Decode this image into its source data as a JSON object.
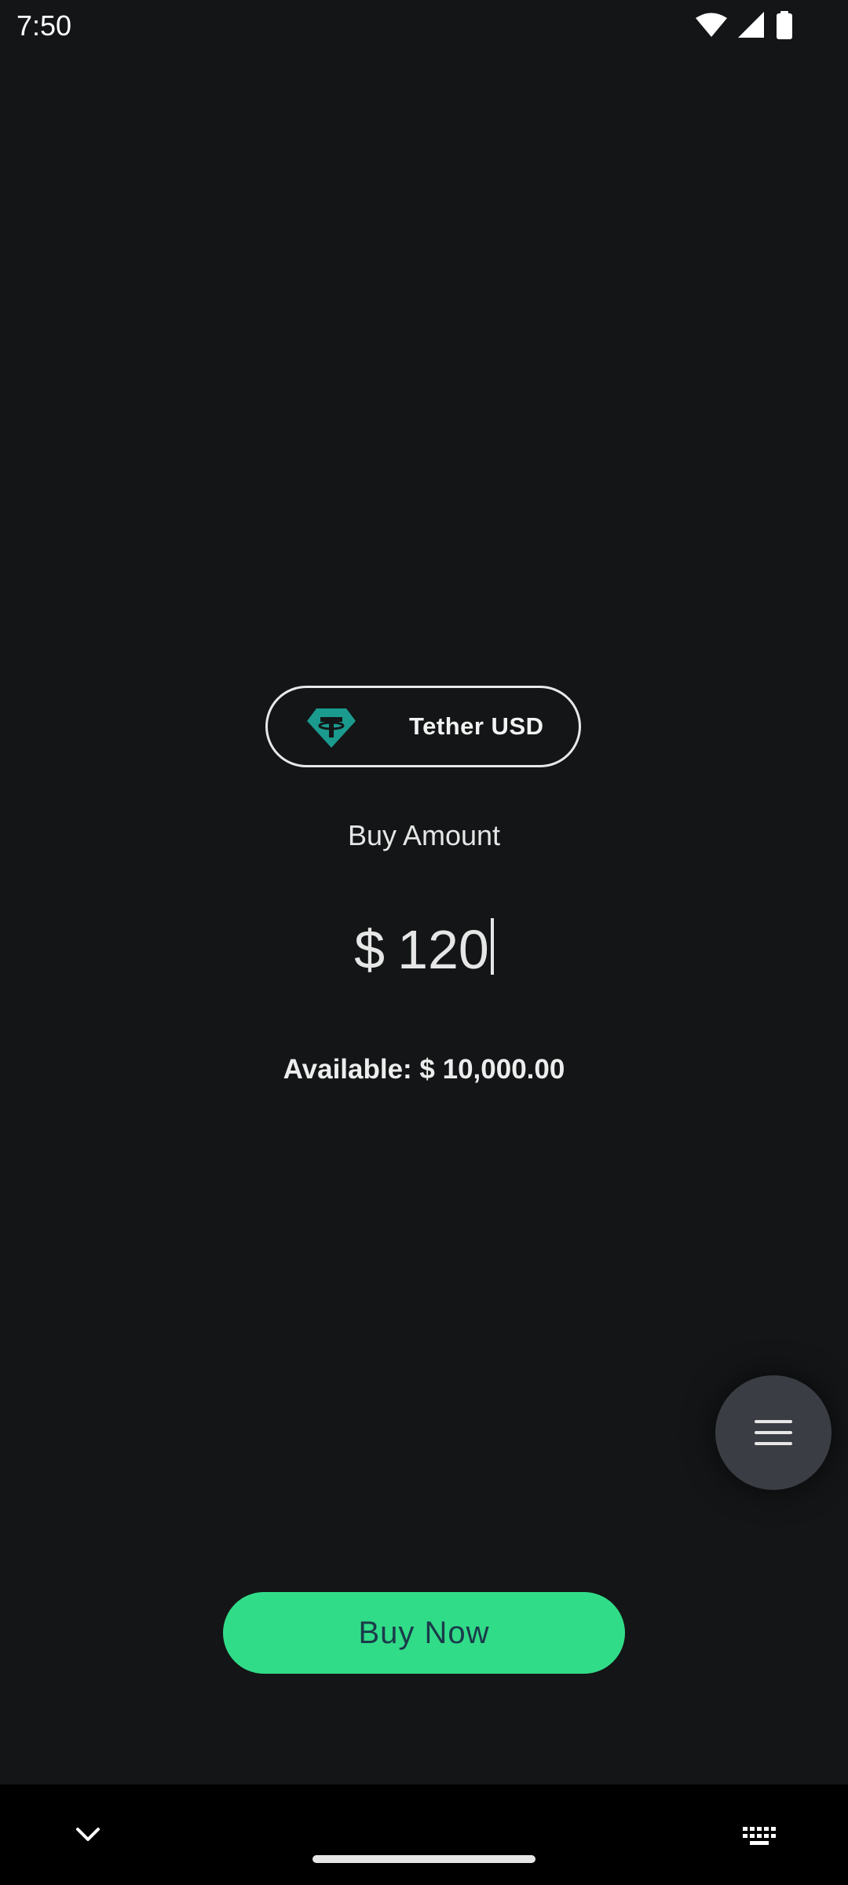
{
  "status_bar": {
    "time": "7:50",
    "icons": [
      "wifi-icon",
      "signal-icon",
      "battery-icon"
    ]
  },
  "token": {
    "name": "Tether USD",
    "icon": "tether-icon",
    "color": "#1b9a8e"
  },
  "buy": {
    "label": "Buy Amount",
    "currency": "$",
    "value": "120"
  },
  "available_text": "Available: $ 10,000.00",
  "fab": {
    "icon": "menu-icon"
  },
  "buy_button": {
    "label": "Buy Now",
    "color": "#31dc88"
  },
  "nav": {
    "icons": [
      "chevron-down-icon",
      "home-handle",
      "keyboard-icon"
    ]
  }
}
